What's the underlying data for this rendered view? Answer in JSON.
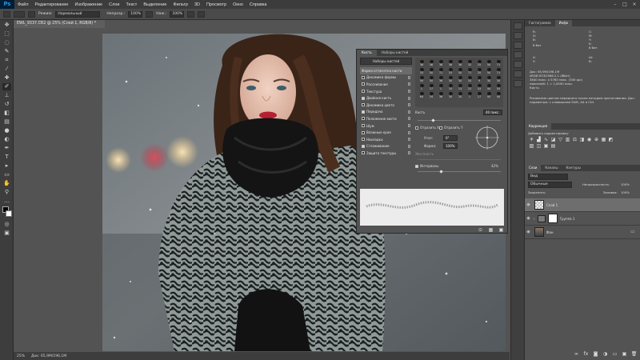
{
  "app": {
    "logo": "Ps"
  },
  "menu": [
    "Файл",
    "Редактирование",
    "Изображение",
    "Слои",
    "Текст",
    "Выделение",
    "Фильтр",
    "3D",
    "Просмотр",
    "Окно",
    "Справка"
  ],
  "options": {
    "mode_label": "Режим:",
    "mode_value": "Нормальный",
    "opacity_label": "Непрозр.:",
    "opacity_value": "100%",
    "flow_label": "Наж.:",
    "flow_value": "100%"
  },
  "document": {
    "tab_title": "EWL_9337.CR2 @ 25% (Слой 1, RGB/8) *",
    "zoom": "25%",
    "doc_size": "Док: 65,9M/196,1M"
  },
  "brush_panel": {
    "tabs": [
      "Кисть",
      "Наборы кистей"
    ],
    "presets_button": "Наборы кистей",
    "options": [
      {
        "label": "Форма отпечатка кисти",
        "checked": null,
        "highlight": true
      },
      {
        "label": "Динамика формы",
        "checked": false
      },
      {
        "label": "Рассеивание",
        "checked": false
      },
      {
        "label": "Текстура",
        "checked": false
      },
      {
        "label": "Двойная кисть",
        "checked": true
      },
      {
        "label": "Динамика цвета",
        "checked": false
      },
      {
        "label": "Передача",
        "checked": true
      },
      {
        "label": "Положение кисти",
        "checked": false
      },
      {
        "label": "Шум",
        "checked": false
      },
      {
        "label": "Влажные края",
        "checked": false
      },
      {
        "label": "Накладка",
        "checked": false
      },
      {
        "label": "Сглаживание",
        "checked": true
      },
      {
        "label": "Защита текстуры",
        "checked": false
      }
    ],
    "brush_numbers": [
      "36",
      "36",
      "36",
      "36",
      "36",
      "32",
      "25",
      "50",
      "71",
      "25",
      "50",
      "71",
      "25",
      "50",
      "71",
      "25",
      "50",
      "71",
      "50",
      "50",
      "36",
      "30",
      "30",
      "20",
      "9",
      "30",
      "30",
      "1",
      "17",
      "1",
      "10",
      "13",
      "22",
      "33",
      "44",
      "55",
      "64",
      "24",
      "36",
      "30",
      "20",
      "1",
      "17",
      "45",
      "40"
    ],
    "size_label": "Кисть",
    "size_value": "40 пикс.",
    "flip_x": "Отразить X",
    "flip_y": "Отразить Y",
    "angle_label": "Угол:",
    "angle_value": "0°",
    "roundness_label": "Форма:",
    "roundness_value": "100%",
    "hardness_label": "Жесткость",
    "spacing_label": "Интервалы",
    "spacing_value": "42%"
  },
  "right_panel": {
    "tabs": [
      "Гистограмма",
      "Инфо"
    ],
    "info_r": "R:",
    "info_g": "G:",
    "info_b": "B:",
    "info_bit": "8 бит",
    "info_c": "C:",
    "info_m": "M:",
    "info_y": "Y:",
    "info_k": "K:",
    "info_bit2": "8 бит",
    "info_x": "X:",
    "info_y2": "Y:",
    "info_w": "Ш:",
    "info_h": "В:",
    "info_lines": [
      "Док: 65,9M/196,1M",
      "sRGB IEC61966-2.1 (8бит)",
      "3840 пикс. x 5760 пикс. (300 ppi)",
      "пикселей: 1 = 1,0000 пикс.",
      "Кисть"
    ],
    "info_hint": "Рисование цветом переднего плана методом протягивания. Доп. параметры: с клавишами Shift, Alt и Ctrl.",
    "adj_tab": "Коррекция",
    "adj_title": "Добавить корректировку",
    "layers_tabs": [
      "Слои",
      "Каналы",
      "Контуры"
    ],
    "kind_label": "Вид",
    "blend_mode": "Обычные",
    "opacity_label": "Непрозрачность:",
    "opacity_value": "100%",
    "lock_label": "Закрепить:",
    "fill_label": "Заливка:",
    "fill_value": "100%",
    "layers": [
      {
        "name": "Слой 1"
      },
      {
        "name": "Группа 1"
      },
      {
        "name": "Фон"
      }
    ]
  }
}
